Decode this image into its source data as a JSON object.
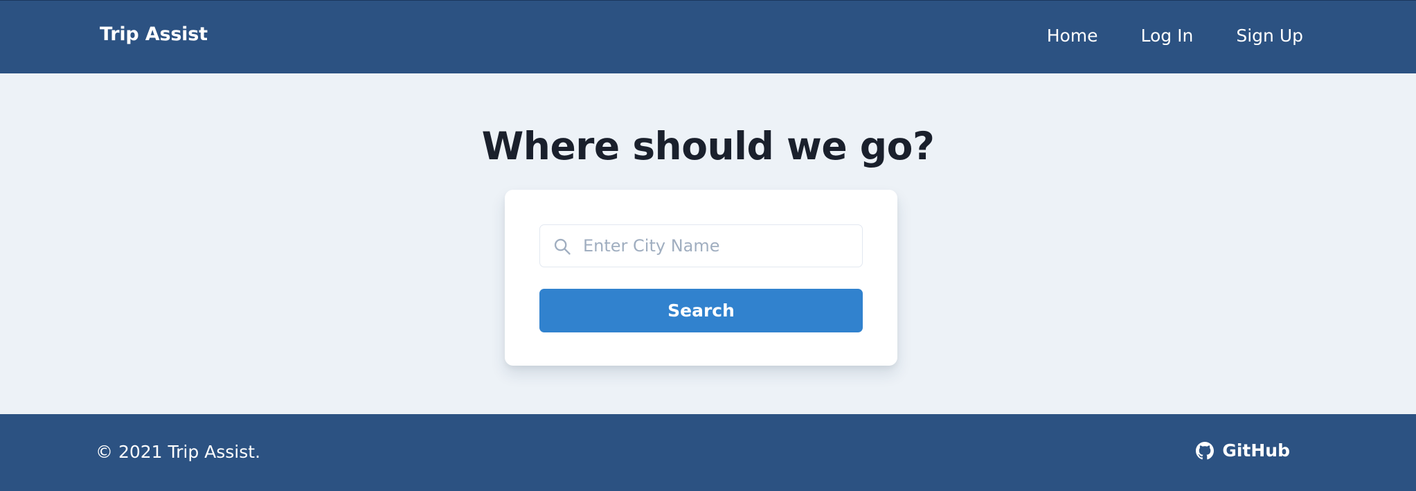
{
  "navbar": {
    "brand": "Trip Assist",
    "links": [
      {
        "label": "Home"
      },
      {
        "label": "Log In"
      },
      {
        "label": "Sign Up"
      }
    ]
  },
  "main": {
    "title": "Where should we go?",
    "search": {
      "placeholder": "Enter City Name",
      "value": "",
      "icon": "search-icon"
    },
    "search_button_label": "Search"
  },
  "footer": {
    "copyright": "© 2021 Trip Assist.",
    "github_label": "GitHub",
    "github_icon": "github-icon"
  },
  "colors": {
    "nav_bg": "#2c5282",
    "page_bg": "#edf2f7",
    "button_bg": "#3182ce",
    "title_text": "#1a202c",
    "placeholder_text": "#a0aec0"
  }
}
